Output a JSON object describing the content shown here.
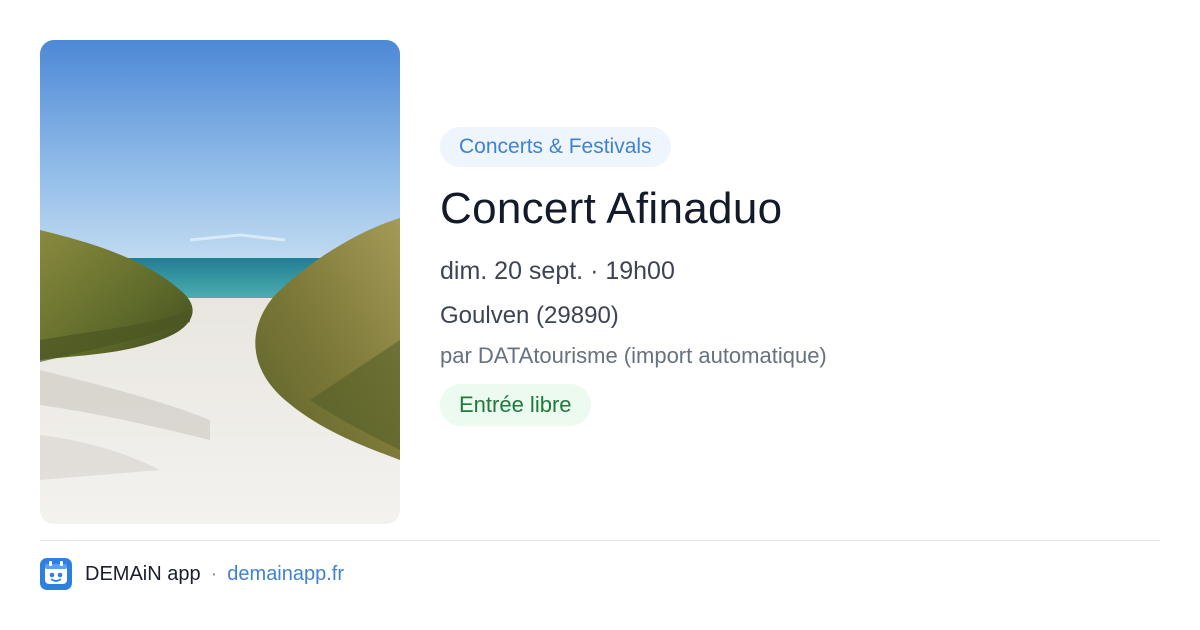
{
  "event": {
    "category": "Concerts & Festivals",
    "title": "Concert Afinaduo",
    "datetime": "dim. 20 sept. · 19h00",
    "location": "Goulven (29890)",
    "source": "par DATAtourisme (import automatique)",
    "price": "Entrée libre"
  },
  "footer": {
    "app_name": "DEMAiN app",
    "separator": "·",
    "url": "demainapp.fr"
  },
  "colors": {
    "accent_blue": "#3f83cf",
    "category_bg": "#eef5fc",
    "free_green": "#1f7a3c",
    "free_bg": "#ecfaef"
  },
  "icons": {
    "app_logo": "demain-app-logo-icon"
  }
}
